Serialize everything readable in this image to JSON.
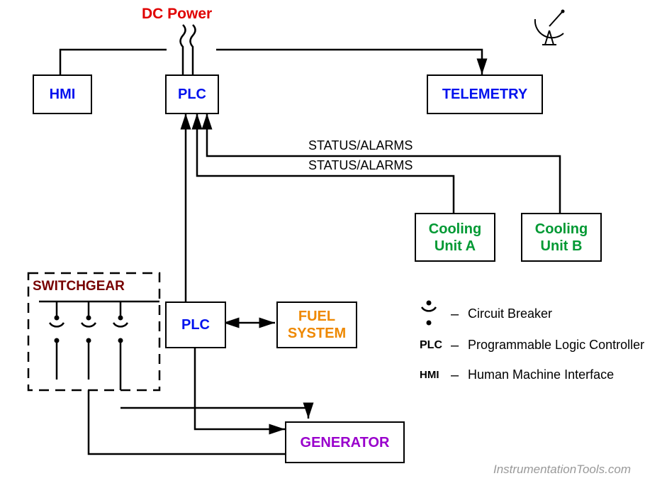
{
  "labels": {
    "dcpower": "DC Power",
    "hmi": "HMI",
    "plc_top": "PLC",
    "telemetry": "TELEMETRY",
    "status_alarms_1": "STATUS/ALARMS",
    "status_alarms_2": "STATUS/ALARMS",
    "cooling_a": "Cooling Unit A",
    "cooling_b": "Cooling Unit B",
    "switchgear": "SWITCHGEAR",
    "plc_bottom": "PLC",
    "fuel_system": "FUEL SYSTEM",
    "generator": "GENERATOR",
    "watermark": "InstrumentationTools.com"
  },
  "legend": {
    "cb_symbol_dash": "–",
    "cb_desc": "Circuit Breaker",
    "plc_symbol": "PLC",
    "plc_dash": "–",
    "plc_desc": "Programmable Logic Controller",
    "hmi_symbol": "HMI",
    "hmi_dash": "–",
    "hmi_desc": "Human Machine Interface"
  }
}
